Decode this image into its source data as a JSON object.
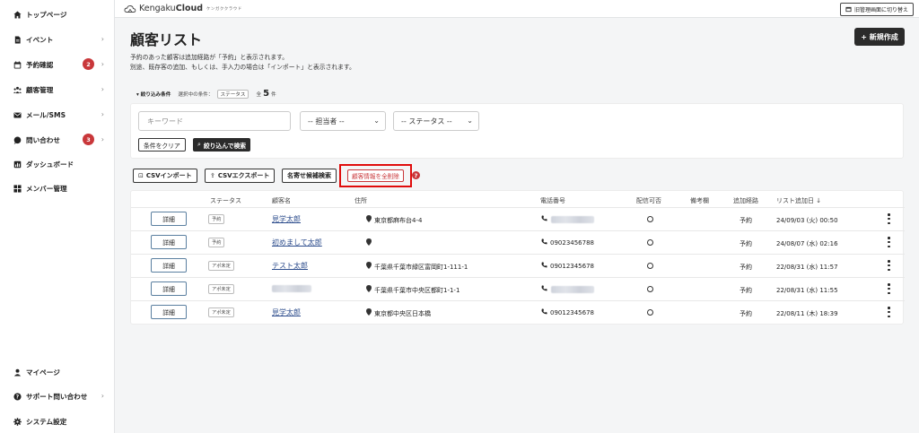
{
  "sidebar": {
    "items": [
      {
        "label": "トップページ",
        "icon": "home-icon",
        "chevron": false
      },
      {
        "label": "イベント",
        "icon": "document-icon",
        "chevron": true
      },
      {
        "label": "予約確認",
        "icon": "calendar-icon",
        "chevron": true,
        "badge": "2"
      },
      {
        "label": "顧客管理",
        "icon": "people-icon",
        "chevron": true
      },
      {
        "label": "メール/SMS",
        "icon": "mail-icon",
        "chevron": true
      },
      {
        "label": "問い合わせ",
        "icon": "chat-icon",
        "chevron": true,
        "badge": "3"
      },
      {
        "label": "ダッシュボード",
        "icon": "chart-icon",
        "chevron": false
      },
      {
        "label": "メンバー管理",
        "icon": "grid-icon",
        "chevron": false
      }
    ],
    "bottom": [
      {
        "label": "マイページ",
        "icon": "user-icon",
        "chevron": false
      },
      {
        "label": "サポート問い合わせ",
        "icon": "help-circle-icon",
        "chevron": true
      },
      {
        "label": "システム設定",
        "icon": "gear-icon",
        "chevron": false
      }
    ],
    "badge_color": "#c9373a"
  },
  "topbar": {
    "logo_text_a": "Kengaku",
    "logo_text_b": "Cloud",
    "logo_tagline": "ケンガククラウド",
    "old_admin_label": "旧管理画面に切り替え"
  },
  "page": {
    "title": "顧客リスト",
    "desc_1": "予約のあった顧客は追加経路が「予約」と表示されます。",
    "desc_2": "別途、既存客の追加、もしくは、手入力の場合は「インポート」と表示されます。",
    "new_button": "+ 新規作成"
  },
  "filter": {
    "toggle_label": "▾ 絞り込み条件",
    "selected_label": "選択中の条件：",
    "selected_chip": "ステータス",
    "count_prefix": "全",
    "count": "5",
    "count_suffix": "件",
    "keyword_placeholder": "キーワード",
    "staff_select": "-- 担当者 --",
    "status_select": "-- ステータス --",
    "clear_button": "条件をクリア",
    "search_button": "絞り込んで検索"
  },
  "actions": {
    "csv_import": "CSVインポート",
    "csv_export": "CSVエクスポート",
    "label_search": "名寄せ候補検索",
    "delete_all": "顧客情報を全削除",
    "help": "?",
    "highlight_color": "#e00c0c"
  },
  "table": {
    "headers": {
      "status": "ステータス",
      "name": "顧客名",
      "address": "住所",
      "phone": "電話番号",
      "deliverable": "配信可否",
      "notes": "備考欄",
      "route": "追加経路",
      "added": "リスト追加日 ↓"
    },
    "detail_label": "詳細",
    "rows": [
      {
        "status": "予約",
        "name": "見学太郎",
        "name_blurred": false,
        "address": "東京都麻布台4-4",
        "phone": "",
        "phone_blurred": true,
        "deliverable": "○",
        "route": "予約",
        "added": "24/09/03 (火) 00:50"
      },
      {
        "status": "予約",
        "name": "初めまして太郎",
        "name_blurred": false,
        "address": "",
        "phone": "09023456788",
        "phone_blurred": false,
        "deliverable": "○",
        "route": "予約",
        "added": "24/08/07 (水) 02:16"
      },
      {
        "status": "アポ未定",
        "name": "テスト太郎",
        "name_blurred": false,
        "address": "千葉県千葉市緑区富岡町1-111-1",
        "phone": "09012345678",
        "phone_blurred": false,
        "deliverable": "○",
        "route": "予約",
        "added": "22/08/31 (水) 11:57"
      },
      {
        "status": "アポ未定",
        "name": "",
        "name_blurred": true,
        "address": "千葉県千葉市中央区都町1-1-1",
        "phone": "",
        "phone_blurred": true,
        "deliverable": "○",
        "route": "予約",
        "added": "22/08/31 (水) 11:55"
      },
      {
        "status": "アポ未定",
        "name": "見学太郎",
        "name_blurred": false,
        "address": "東京都中央区日本橋",
        "phone": "09012345678",
        "phone_blurred": false,
        "deliverable": "○",
        "route": "予約",
        "added": "22/08/11 (木) 18:39"
      }
    ]
  }
}
